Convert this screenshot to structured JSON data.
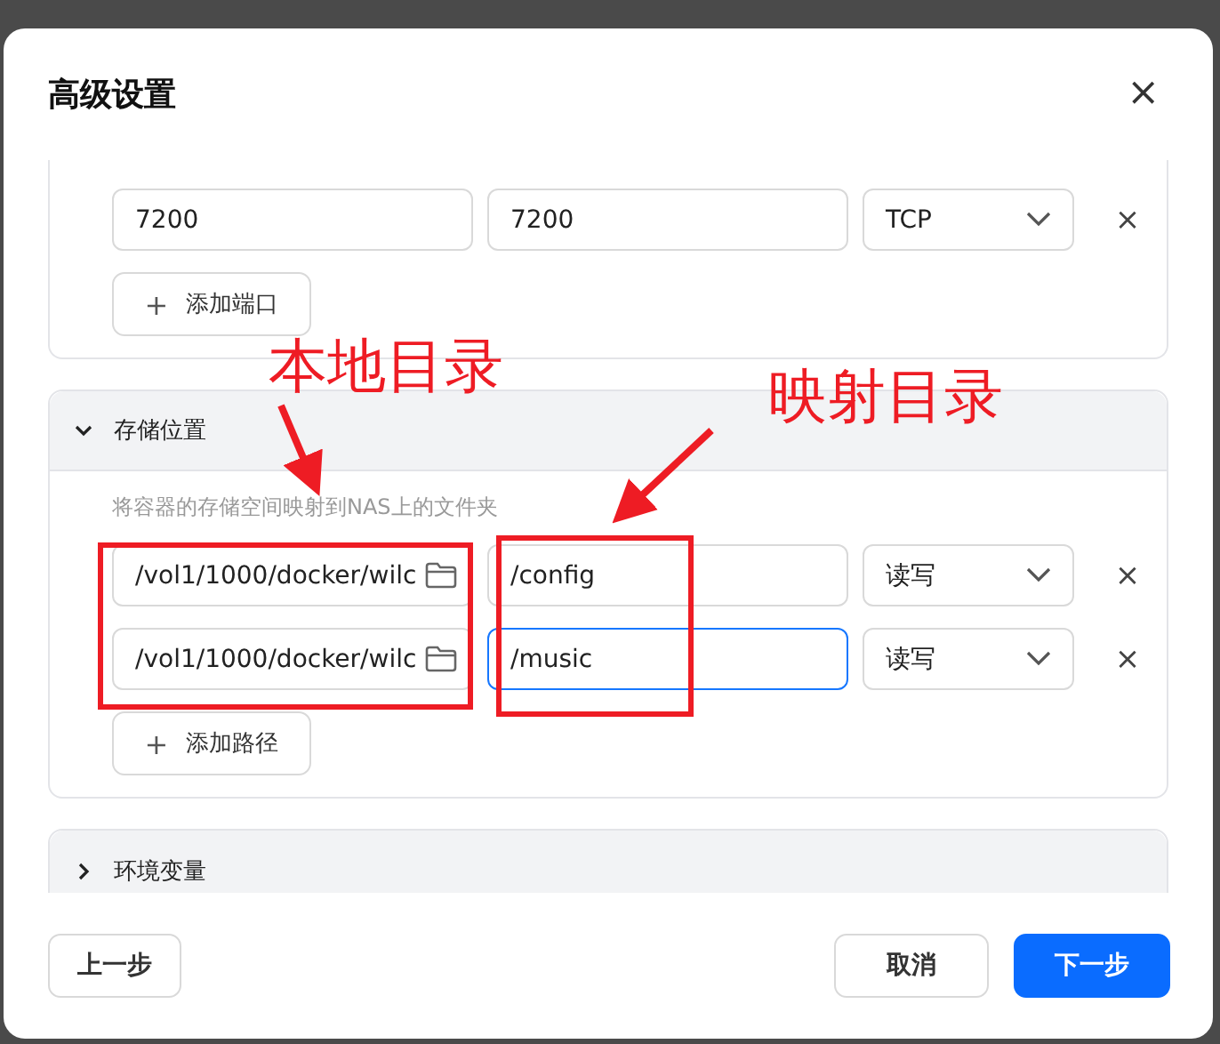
{
  "dialog": {
    "title": "高级设置",
    "close": "×"
  },
  "ports": {
    "rows": [
      {
        "host": "7200",
        "container": "7200",
        "protocol": "TCP",
        "remove": "×"
      }
    ],
    "add_button": {
      "icon": "+",
      "label": "添加端口"
    }
  },
  "storage": {
    "title": "存储位置",
    "expanded": true,
    "hint": "将容器的存储空间映射到NAS上的文件夹",
    "rows": [
      {
        "local": "/vol1/1000/docker/wilc",
        "mapped": "/config",
        "focused": false,
        "mode": "读写",
        "remove": "×"
      },
      {
        "local": "/vol1/1000/docker/wilc",
        "mapped": "/music",
        "focused": true,
        "mode": "读写",
        "remove": "×"
      }
    ],
    "add_button": {
      "icon": "+",
      "label": "添加路径"
    }
  },
  "env": {
    "title": "环境变量",
    "expanded": false
  },
  "footer": {
    "back": "上一步",
    "cancel": "取消",
    "next": "下一步"
  },
  "annotations": [
    {
      "text": "本地目录"
    },
    {
      "text": "映射目录"
    }
  ]
}
